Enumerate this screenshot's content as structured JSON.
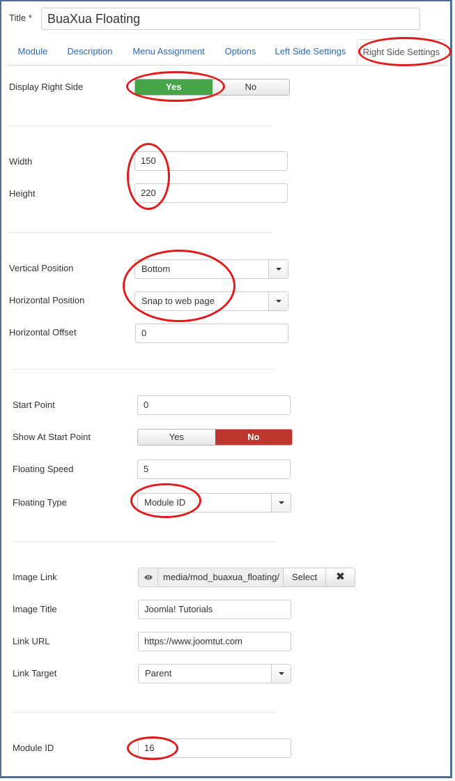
{
  "header": {
    "title_label": "Title *",
    "title_value": "BuaXua Floating"
  },
  "tabs": [
    {
      "label": "Module"
    },
    {
      "label": "Description"
    },
    {
      "label": "Menu Assignment"
    },
    {
      "label": "Options"
    },
    {
      "label": "Left Side Settings"
    },
    {
      "label": "Right Side Settings",
      "active": true
    }
  ],
  "fields": {
    "display_right_side": {
      "label": "Display Right Side",
      "yes": "Yes",
      "no": "No",
      "selected": "Yes"
    },
    "width": {
      "label": "Width",
      "value": "150"
    },
    "height": {
      "label": "Height",
      "value": "220"
    },
    "vertical_position": {
      "label": "Vertical Position",
      "value": "Bottom"
    },
    "horizontal_position": {
      "label": "Horizontal Position",
      "value": "Snap to web page"
    },
    "horizontal_offset": {
      "label": "Horizontal Offset",
      "value": "0"
    },
    "start_point": {
      "label": "Start Point",
      "value": "0"
    },
    "show_at_start_point": {
      "label": "Show At Start Point",
      "yes": "Yes",
      "no": "No",
      "selected": "No"
    },
    "floating_speed": {
      "label": "Floating Speed",
      "value": "5"
    },
    "floating_type": {
      "label": "Floating Type",
      "value": "Module ID"
    },
    "image_link": {
      "label": "Image Link",
      "value": "media/mod_buaxua_floating/",
      "select_label": "Select",
      "clear_label": "✖"
    },
    "image_title": {
      "label": "Image Title",
      "value": "Joomla! Tutorials"
    },
    "link_url": {
      "label": "Link URL",
      "value": "https://www.joomtut.com"
    },
    "link_target": {
      "label": "Link Target",
      "value": "Parent"
    },
    "module_id": {
      "label": "Module ID",
      "value": "16"
    }
  },
  "colors": {
    "yes_active": "#46a546",
    "no_active": "#bd362f",
    "annotation": "#e01b1b",
    "link": "#2a69b8"
  }
}
